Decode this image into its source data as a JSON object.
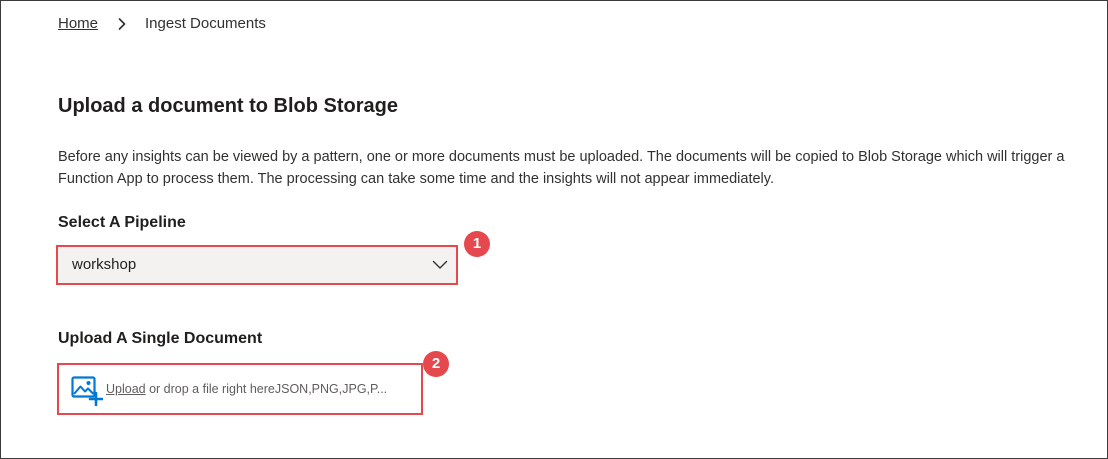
{
  "breadcrumb": {
    "home": "Home",
    "current": "Ingest Documents"
  },
  "section": {
    "title": "Upload a document to Blob Storage",
    "description": "Before any insights can be viewed by a pattern, one or more documents must be uploaded. The documents will be copied to Blob Storage which will trigger a Function App to process them. The processing can take some time and the insights will not appear immediately."
  },
  "pipeline": {
    "label": "Select A Pipeline",
    "selected": "workshop"
  },
  "upload": {
    "label": "Upload A Single Document",
    "link": "Upload",
    "hint": " or drop a file right hereJSON,PNG,JPG,P..."
  },
  "annotations": {
    "step1": "1",
    "step2": "2"
  },
  "colors": {
    "accent": "#e5484d",
    "icon": "#0078d4",
    "dropdown_bg": "#f3f2f1"
  },
  "icons": {
    "breadcrumb_separator": "chevron-right-icon",
    "dropdown": "chevron-down-icon",
    "upload": "image-add-icon"
  }
}
